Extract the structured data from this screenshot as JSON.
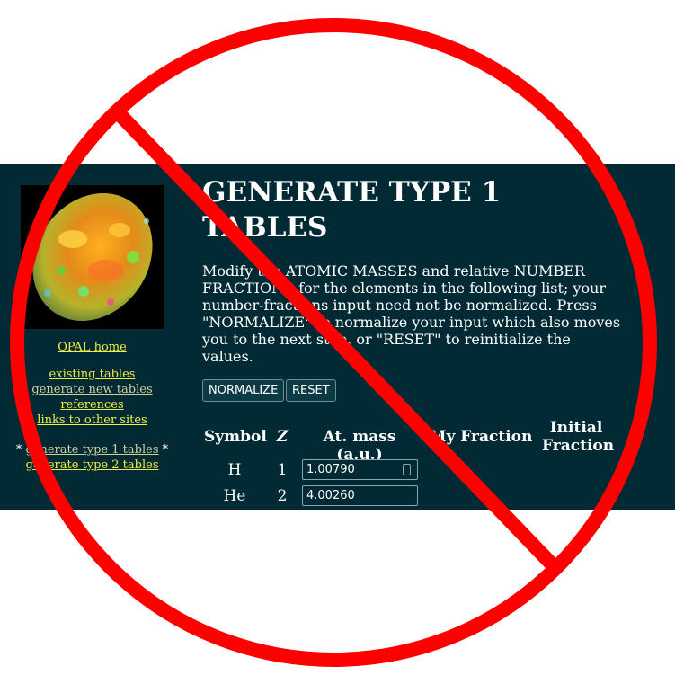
{
  "sidebar": {
    "home": "OPAL home",
    "links": [
      "existing tables",
      "generate new tables",
      "references",
      "links to other sites"
    ],
    "current_prefix": "* ",
    "current": "generate type 1 tables",
    "current_suffix": " *",
    "type2": "generate type 2 tables"
  },
  "main": {
    "title": "GENERATE TYPE 1 TABLES",
    "intro": "Modify the ATOMIC MASSES and relative NUMBER FRACTIONS for the elements in the following list; your number-fractions input need not be normalized. Press \"NORMALIZE\" to normalize your input which also moves you to the next step, or \"RESET\" to reinitialize the values.",
    "buttons": {
      "normalize": "NORMALIZE",
      "reset": "RESET"
    },
    "table": {
      "headers": {
        "symbol": "Symbol",
        "z": "Z",
        "mass": "At. mass (a.u.)",
        "my_fraction": "My Fraction",
        "initial_fraction": "Initial Fraction"
      },
      "rows": [
        {
          "symbol": "H",
          "z": "1",
          "mass": "1.00790"
        },
        {
          "symbol": "He",
          "z": "2",
          "mass": "4.00260"
        }
      ]
    }
  },
  "colors": {
    "background": "#022a35",
    "link": "#eeee44",
    "visited_link": "#cfcf9c",
    "overlay": "#ff0000"
  },
  "icons": {
    "overlay": "prohibition-sign-icon",
    "photo": "opal-gemstone-icon"
  }
}
